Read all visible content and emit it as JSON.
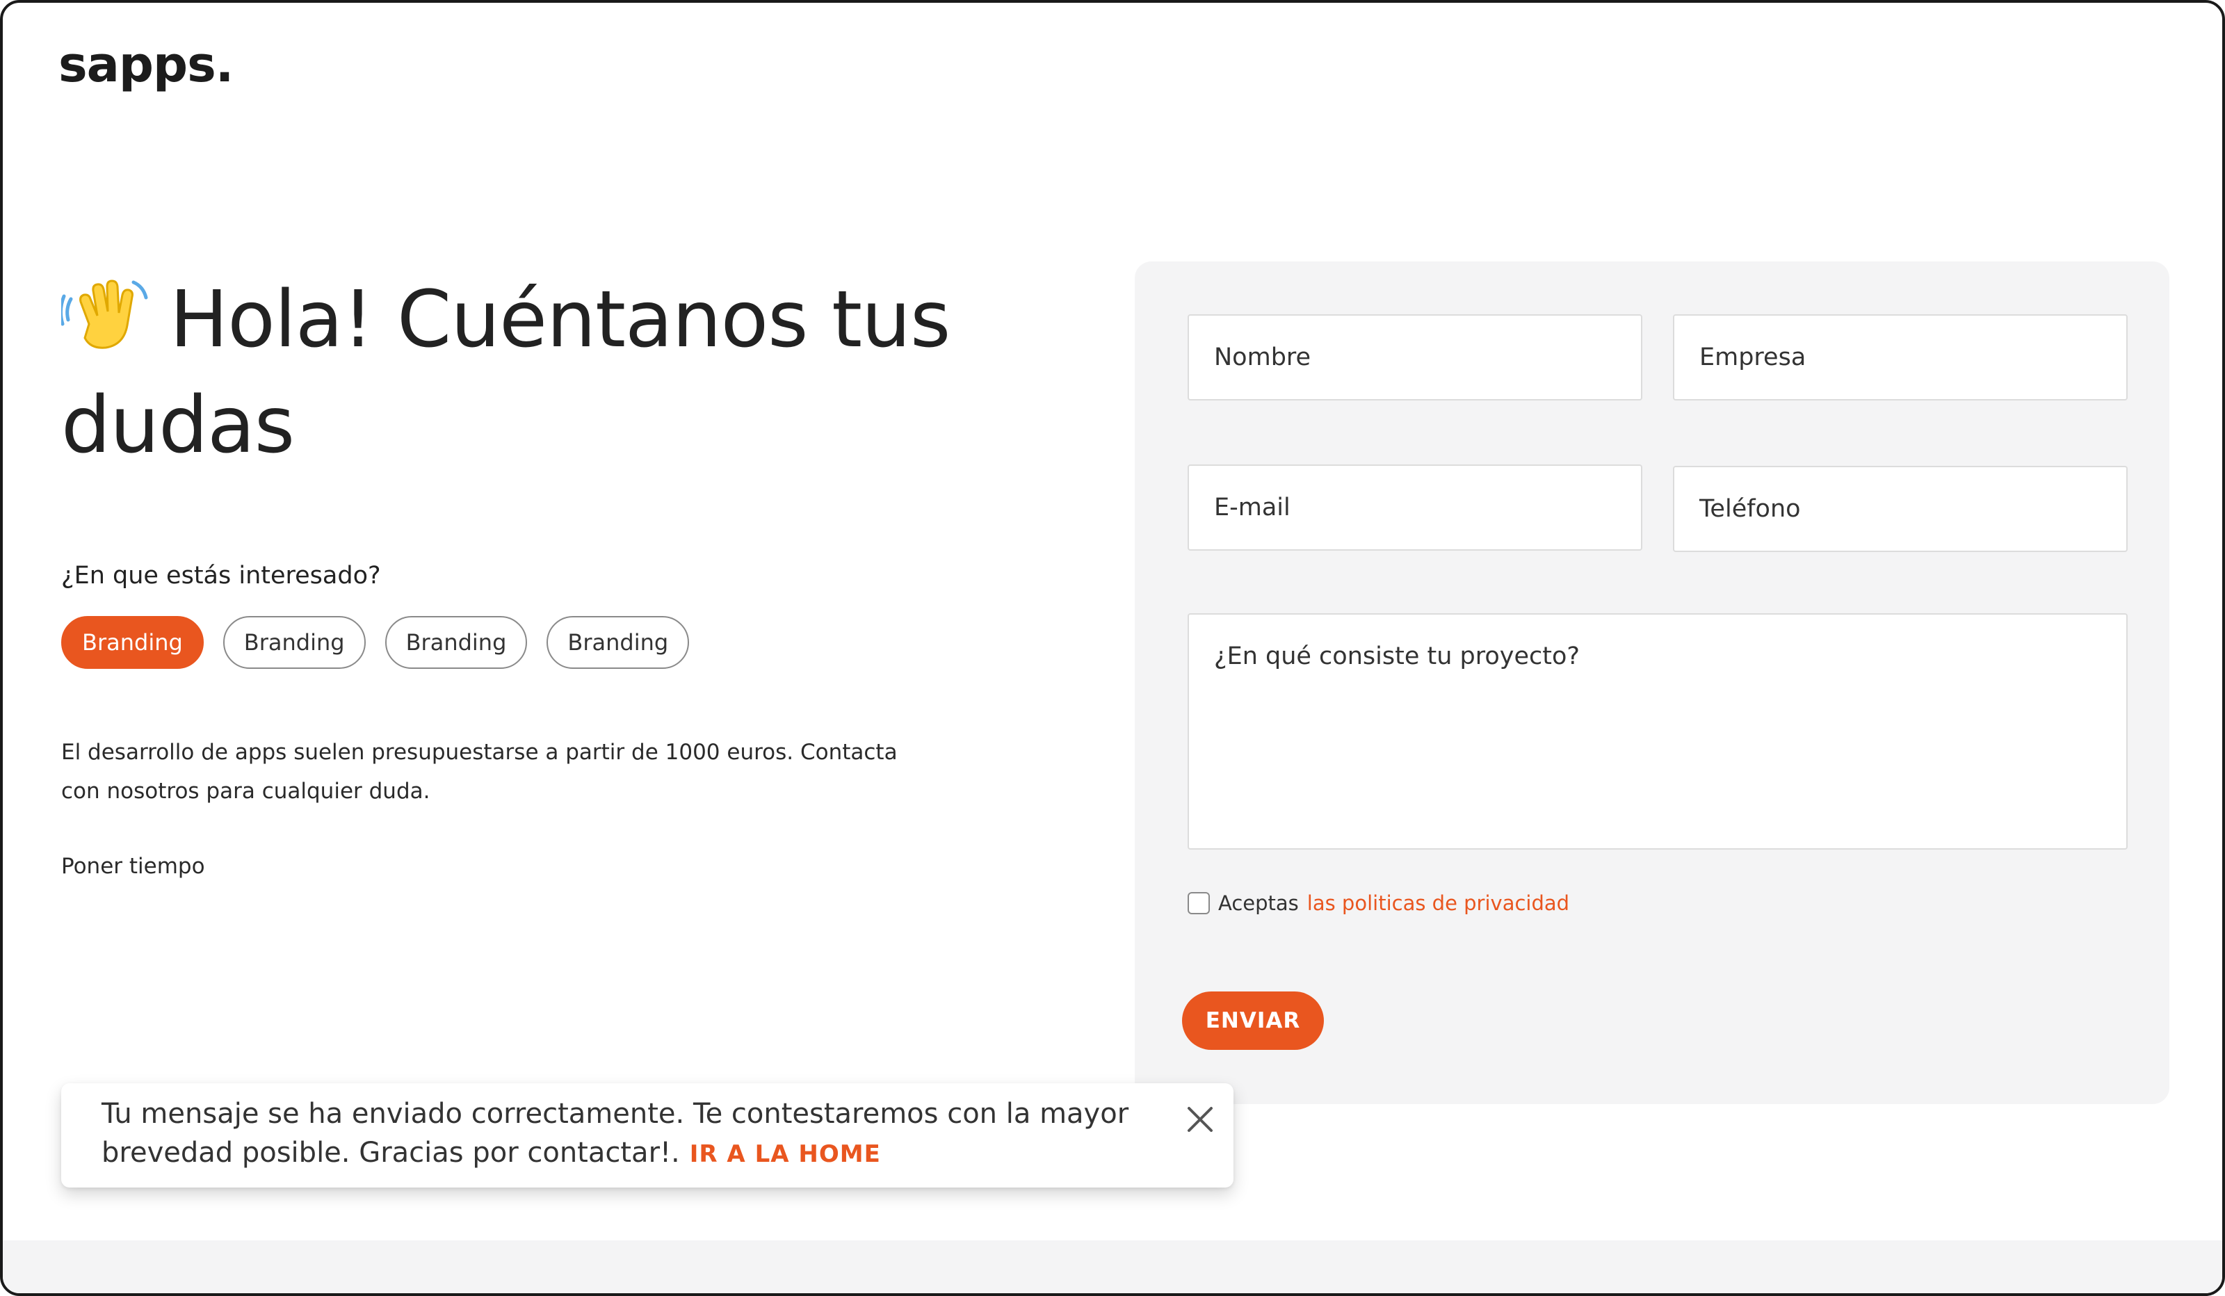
{
  "brand": {
    "logo": "sapps.",
    "accent_color": "#e9561f"
  },
  "hero": {
    "wave_icon": "waving-hand-icon",
    "heading": "Hola! Cuéntanos tus dudas"
  },
  "interests": {
    "question": "¿En que estás interesado?",
    "chips": [
      {
        "label": "Branding",
        "selected": true
      },
      {
        "label": "Branding",
        "selected": false
      },
      {
        "label": "Branding",
        "selected": false
      },
      {
        "label": "Branding",
        "selected": false
      }
    ]
  },
  "info": {
    "text": "El desarrollo de apps suelen presupuestarse a partir de 1000 euros. Contacta con nosotros para cualquier duda.",
    "time_note": "Poner tiempo"
  },
  "form": {
    "name_placeholder": "Nombre",
    "company_placeholder": "Empresa",
    "email_placeholder": "E-mail",
    "phone_placeholder": "Teléfono",
    "project_placeholder": "¿En qué consiste tu proyecto?",
    "privacy_prefix": "Aceptas",
    "privacy_link": "las politicas de privacidad",
    "submit_label": "ENVIAR"
  },
  "toast": {
    "message": "Tu mensaje se ha enviado correctamente. Te contestaremos con la mayor brevedad posible. Gracias por contactar!.",
    "link": "IR A LA HOME",
    "close_icon": "close-icon"
  }
}
